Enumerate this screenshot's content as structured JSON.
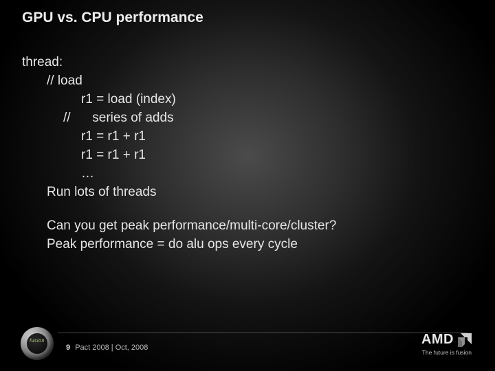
{
  "title": "GPU vs. CPU performance",
  "code": {
    "l1": "thread:",
    "l2": "// load",
    "l3": "r1 = load (index)",
    "l4a": "//",
    "l4b": "series of  adds",
    "l5": "r1 = r1 + r1",
    "l6": "r1 = r1 + r1",
    "l7": "…",
    "l8": "Run  lots of threads"
  },
  "q1": "Can you get peak performance/multi-core/cluster?",
  "q2": "Peak performance = do alu ops every cycle",
  "footer": {
    "page": "9",
    "conf": "Pact 2008 | Oct, 2008"
  },
  "fusion": {
    "label": "fusion"
  },
  "amd": {
    "name": "AMD",
    "tagline": "The future is fusion"
  }
}
